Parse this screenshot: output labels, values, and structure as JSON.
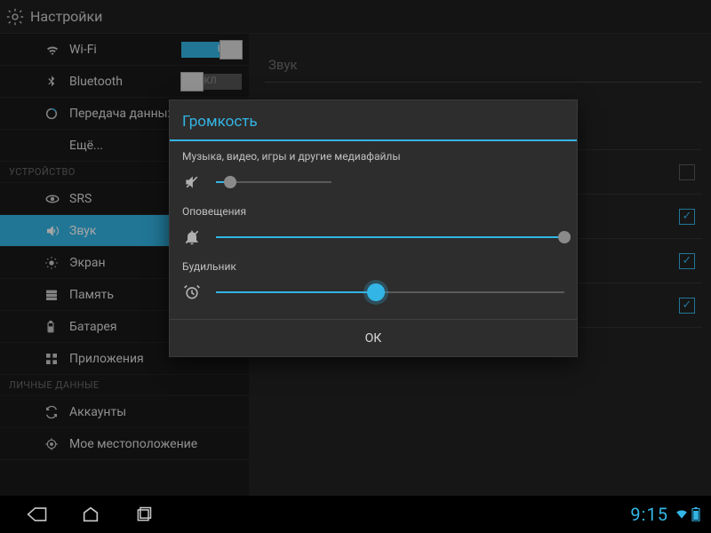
{
  "topbar": {
    "title": "Настройки"
  },
  "sidebar": {
    "wifi": {
      "label": "Wi-Fi",
      "toggle": "ВКЛ",
      "on": true
    },
    "bluetooth": {
      "label": "Bluetooth",
      "toggle": "ВЫКЛ",
      "on": false
    },
    "data": {
      "label": "Передача данных"
    },
    "more": {
      "label": "Ещё..."
    },
    "section_device": "УСТРОЙСТВО",
    "srs": {
      "label": "SRS"
    },
    "sound": {
      "label": "Звук"
    },
    "display": {
      "label": "Экран"
    },
    "storage": {
      "label": "Память"
    },
    "battery": {
      "label": "Батарея"
    },
    "apps": {
      "label": "Приложения"
    },
    "section_personal": "ЛИЧНЫЕ ДАННЫЕ",
    "accounts": {
      "label": "Аккаунты"
    },
    "location": {
      "label": "Мое местоположение"
    }
  },
  "content": {
    "header": "Звук",
    "rows": [
      {
        "checkbox": false,
        "checked": false
      },
      {
        "checkbox": true,
        "checked": true
      },
      {
        "checkbox": true,
        "checked": true
      },
      {
        "checkbox": true,
        "checked": true
      }
    ]
  },
  "dialog": {
    "title": "Громкость",
    "media": {
      "label": "Музыка, видео, игры и другие медиафайлы",
      "value": 12
    },
    "notif": {
      "label": "Оповещения",
      "value": 100
    },
    "alarm": {
      "label": "Будильник",
      "value": 46
    },
    "ok": "ОК"
  },
  "navbar": {
    "clock": "9:15"
  },
  "colors": {
    "accent": "#33b5e5"
  }
}
